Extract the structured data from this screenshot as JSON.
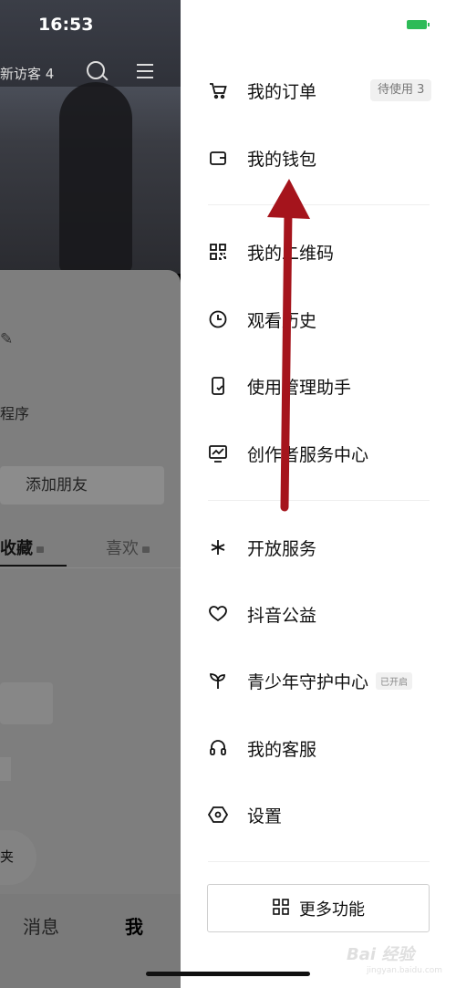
{
  "status": {
    "time": "16:53"
  },
  "profile": {
    "visitors": "新访客 4",
    "fragment_text": "",
    "program_text": "程序",
    "add_friend": "添加朋友",
    "tabs": [
      {
        "label": "收藏"
      },
      {
        "label": "喜欢"
      }
    ],
    "float_text": "夹",
    "nav": {
      "messages": "消息",
      "me": "我"
    }
  },
  "drawer": {
    "items": [
      {
        "label": "我的订单",
        "icon": "cart-icon"
      },
      {
        "label": "我的钱包",
        "icon": "wallet-icon"
      },
      {
        "label": "我的二维码",
        "icon": "qr-code-icon"
      },
      {
        "label": "观看历史",
        "icon": "clock-icon"
      },
      {
        "label": "使用管理助手",
        "icon": "phone-shield-icon"
      },
      {
        "label": "创作者服务中心",
        "icon": "chart-monitor-icon"
      },
      {
        "label": "开放服务",
        "icon": "sparkle-icon"
      },
      {
        "label": "抖音公益",
        "icon": "heart-hands-icon"
      },
      {
        "label": "青少年守护中心",
        "icon": "sprout-icon"
      },
      {
        "label": "我的客服",
        "icon": "headset-icon"
      },
      {
        "label": "设置",
        "icon": "settings-icon"
      }
    ],
    "order_badge": "待使用 3",
    "youth_tag": "已开启",
    "more_button": "更多功能"
  },
  "watermark": {
    "logo": "Bai 经验",
    "url": "jingyan.baidu.com"
  },
  "colors": {
    "battery": "#2dbb57",
    "arrow": "#a5141c"
  }
}
